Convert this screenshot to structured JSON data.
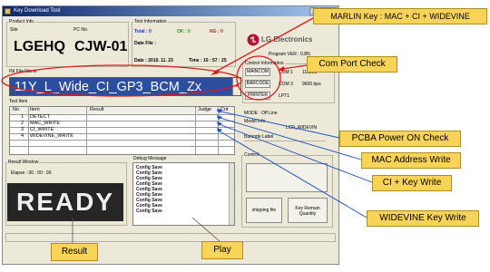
{
  "window": {
    "title": "Key Download Tool"
  },
  "product_info": {
    "group_label": "Product Info.",
    "site_label": "Site",
    "site_value": "LGEHQ",
    "pcno_label": "PC No.",
    "pcno_value": "CJW-01"
  },
  "test_info": {
    "group_label": "Test Information",
    "total": "Total : 0",
    "ok": "OK : 0",
    "ng": "NG : 0",
    "date_file": "Date File :",
    "date": "Date : 2010. 11. 23",
    "time": "Time : 10 : 57 : 25"
  },
  "brand": {
    "name": "LG Electronics",
    "program_version": "Program VER : 0.8N."
  },
  "ini": {
    "label": "INI File Name",
    "value": "11Y_L_Wide_CI_GP3_BCM_Zx",
    "dropdown_glyph": "▾"
  },
  "control_info": {
    "group_label": "Control Information",
    "ports": [
      {
        "device": "MAINCOM",
        "port": "COM 1",
        "rate": "115200"
      },
      {
        "device": "BARCODE",
        "port": "COM 3",
        "rate": "9600 bps"
      },
      {
        "device": "PRINTER",
        "port": "LPT1",
        "rate": ""
      }
    ],
    "mode": "MODE :  Off Line",
    "model_info": "Model Info",
    "model_value": "LCD_WIDEVIN",
    "barcode_label": "Barcode Label",
    "control_label": "Control"
  },
  "test_item": {
    "group_label": "Test Item",
    "headers": [
      "No",
      "Item",
      "Result",
      "Judge",
      "Cnt"
    ],
    "rows": [
      {
        "no": "1",
        "item": "DETECT"
      },
      {
        "no": "2",
        "item": "MAC_WRITE"
      },
      {
        "no": "3",
        "item": "CI_WRITE"
      },
      {
        "no": "4",
        "item": "WIDEVINE_WRITE"
      }
    ]
  },
  "result_window": {
    "label": "Result Window",
    "elapse": "Elapse :  00 : 00 : 00",
    "status": "READY"
  },
  "debug": {
    "label": "Debug Message",
    "lines": [
      "Config Save",
      "Config Save",
      "Config Save",
      "Config Save",
      "Config Save",
      "Config Save",
      "Config Save",
      "Config Save",
      "Config Save"
    ]
  },
  "buttons": {
    "play_glyph": "",
    "shipping": "shipping file",
    "key_remain_1": "Key Remain",
    "key_remain_2": "Quantity"
  },
  "callouts": {
    "marlin": "MARLIN Key : MAC + CI + WIDEVINE",
    "com_port": "Com Port Check",
    "pcba": "PCBA Power ON Check",
    "mac": "MAC Address Write",
    "ci": "CI +  Key Write",
    "widevine": "WIDEVINE Key Write",
    "result": "Result",
    "play": "Play"
  },
  "colors": {
    "annotation_fill": "#f7d358",
    "annotation_line": "#e01818",
    "leader_line": "#1e4fbf",
    "ini_highlight": "#2c4e9e",
    "brand_red": "#b5123a"
  }
}
